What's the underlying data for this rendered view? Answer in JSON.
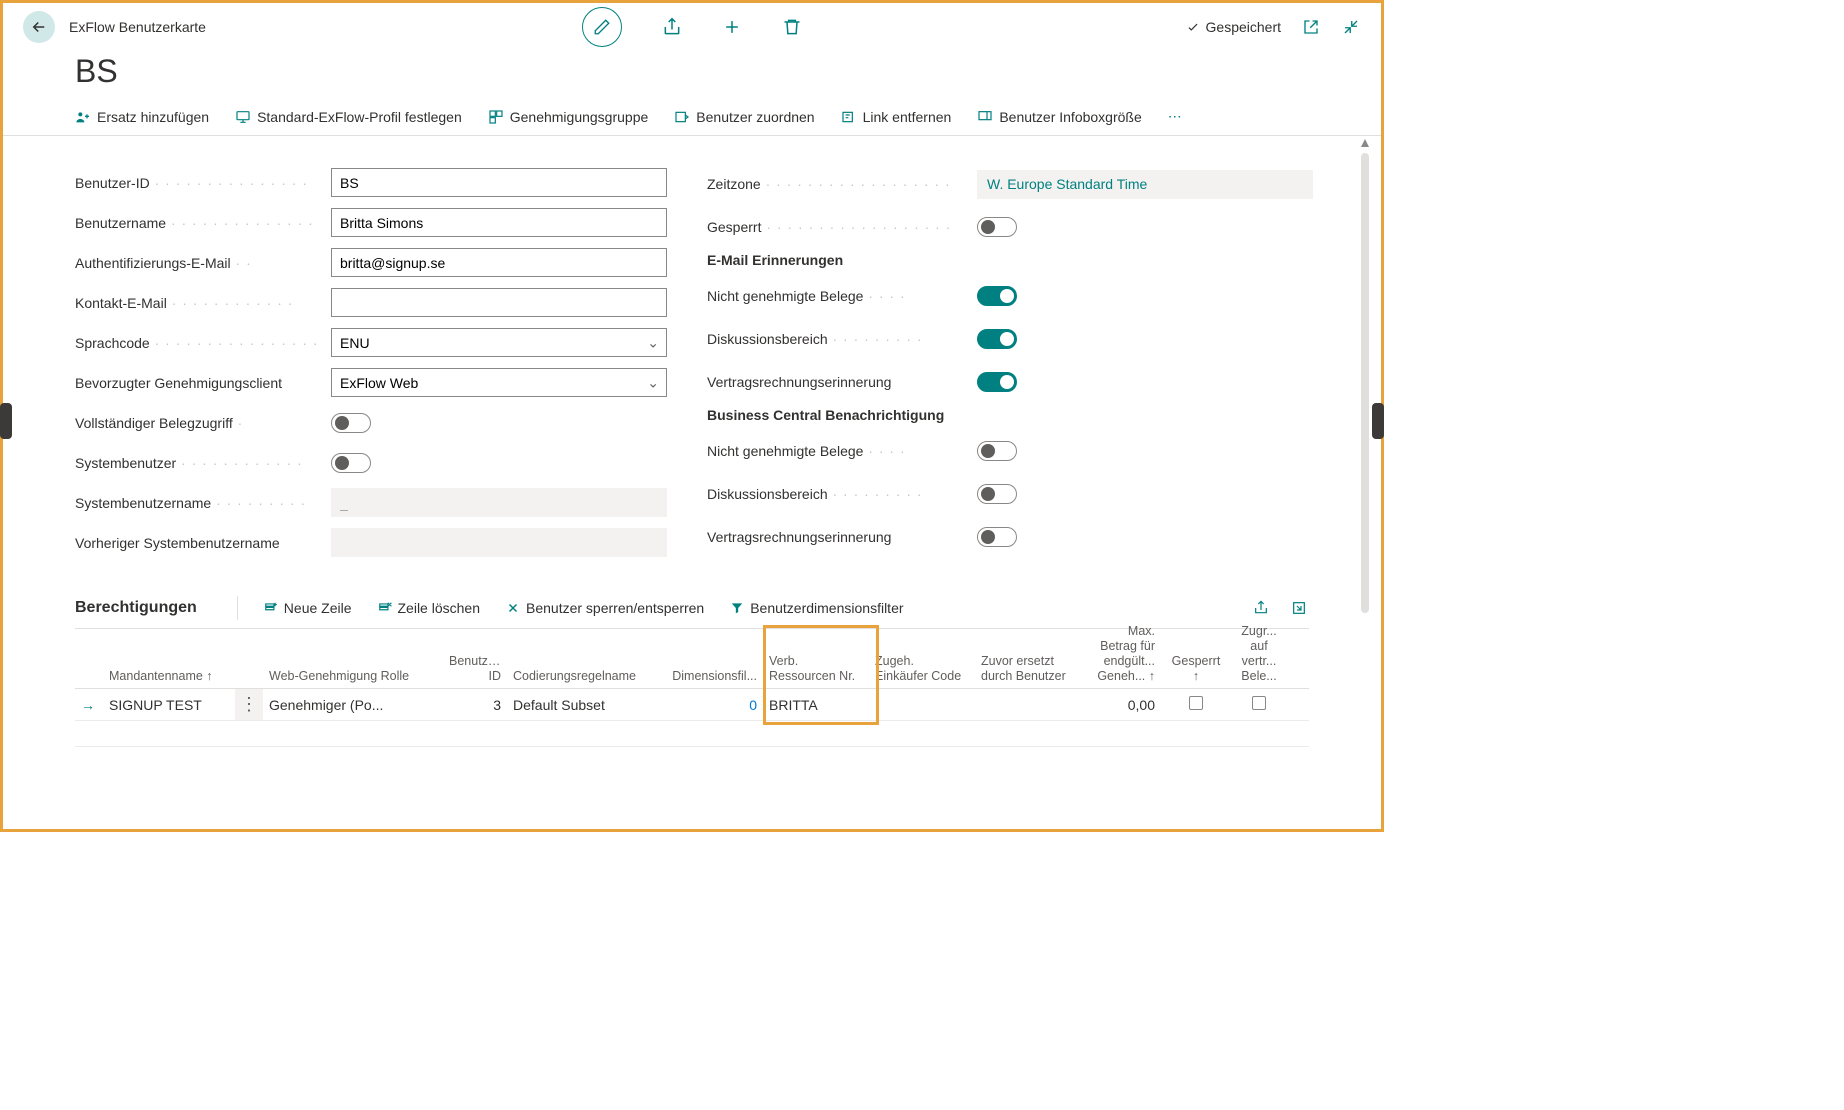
{
  "header": {
    "title": "ExFlow Benutzerkarte",
    "saved": "Gespeichert"
  },
  "mainTitle": "BS",
  "actions": {
    "a1": "Ersatz hinzufügen",
    "a2": "Standard-ExFlow-Profil festlegen",
    "a3": "Genehmigungsgruppe",
    "a4": "Benutzer zuordnen",
    "a5": "Link entfernen",
    "a6": "Benutzer Infoboxgröße"
  },
  "fields": {
    "userId": {
      "label": "Benutzer-ID",
      "value": "BS"
    },
    "userName": {
      "label": "Benutzername",
      "value": "Britta Simons"
    },
    "authEmail": {
      "label": "Authentifizierungs-E-Mail",
      "value": "britta@signup.se"
    },
    "contactEmail": {
      "label": "Kontakt-E-Mail",
      "value": ""
    },
    "langCode": {
      "label": "Sprachcode",
      "value": "ENU"
    },
    "prefClient": {
      "label": "Bevorzugter Genehmigungsclient",
      "value": "ExFlow Web"
    },
    "fullAccess": {
      "label": "Vollständiger Belegzugriff"
    },
    "sysUser": {
      "label": "Systembenutzer"
    },
    "sysUserName": {
      "label": "Systembenutzername",
      "value": "_"
    },
    "prevSysUserName": {
      "label": "Vorheriger Systembenutzername",
      "value": ""
    },
    "timezone": {
      "label": "Zeitzone",
      "value": "W. Europe Standard Time"
    },
    "blocked": {
      "label": "Gesperrt"
    }
  },
  "sections": {
    "emailReminders": "E-Mail Erinnerungen",
    "bcNotif": "Business Central Benachrichtigung"
  },
  "reminders": {
    "unapproved": {
      "label": "Nicht genehmigte Belege"
    },
    "discussion": {
      "label": "Diskussionsbereich"
    },
    "contract": {
      "label": "Vertragsrechnungserinnerung"
    }
  },
  "subgrid": {
    "title": "Berechtigungen",
    "newRow": "Neue Zeile",
    "delRow": "Zeile löschen",
    "lockUser": "Benutzer sperren/entsperren",
    "dimFilter": "Benutzerdimensionsfilter",
    "columns": {
      "tenant": "Mandantenname ↑",
      "role": "Web-Genehmigung Rolle",
      "codeId": "Benutzercodi... ID",
      "ruleName": "Codierungsregelname",
      "dimFil": "Dimensionsfil...",
      "resNo": "Verb. Ressourcen Nr.",
      "buyerCode": "Zugeh. Einkäufer Code",
      "replacedBy": "Zuvor ersetzt durch Benutzer",
      "maxAmount": "Max. Betrag für endgült... Geneh... ↑",
      "locked": "Gesperrt ↑",
      "access": "Zugr... auf vertr... Bele..."
    },
    "row": {
      "tenant": "SIGNUP TEST",
      "role": "Genehmiger (Po...",
      "codeId": "3",
      "ruleName": "Default Subset",
      "dimFil": "0",
      "resNo": "BRITTA",
      "buyerCode": "",
      "replacedBy": "",
      "maxAmount": "0,00"
    }
  }
}
